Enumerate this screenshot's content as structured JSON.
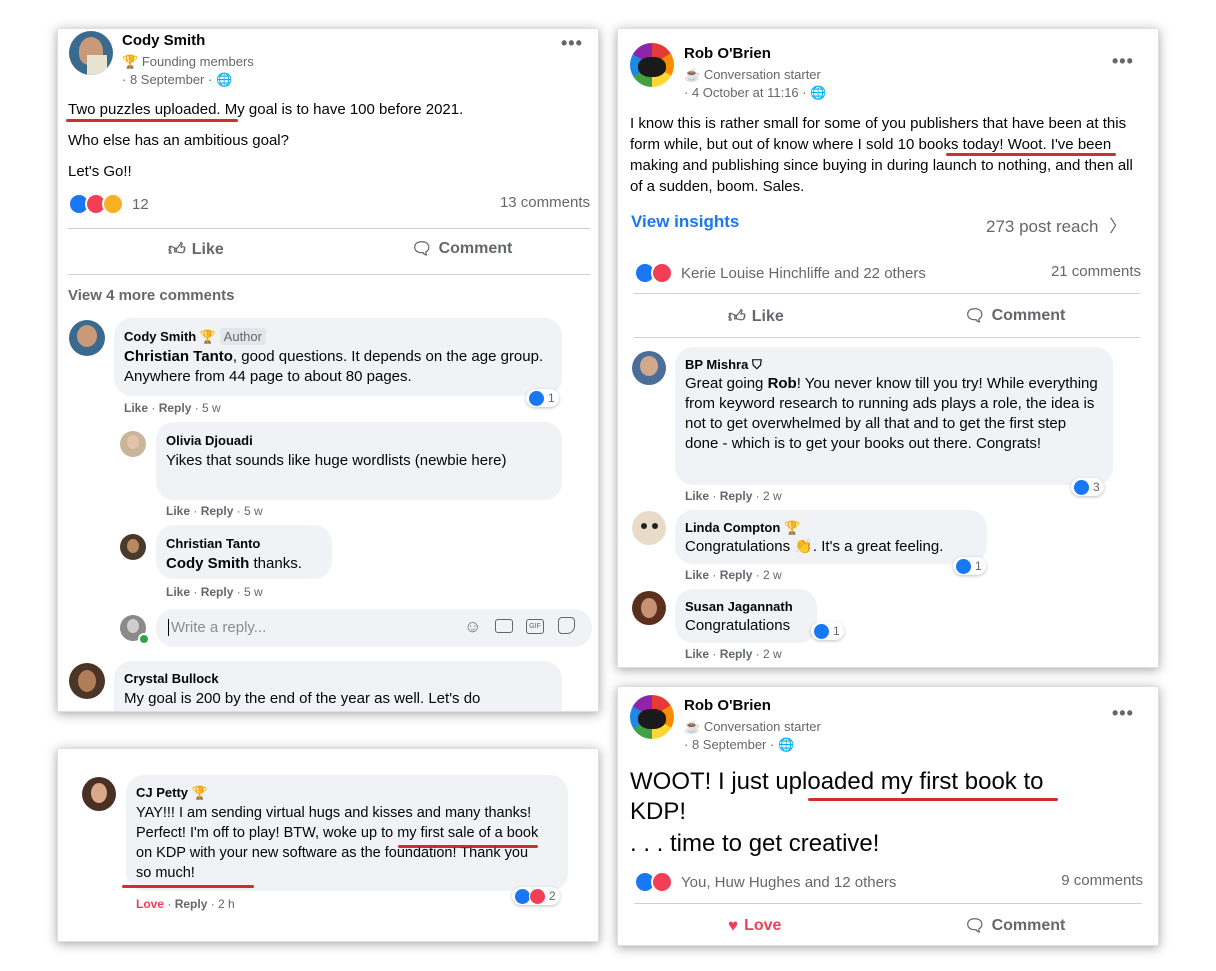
{
  "card1": {
    "author": "Cody Smith",
    "badge": "Founding members",
    "date": "· 8 September ·",
    "body": [
      "Two puzzles uploaded. My goal is to have 100 before 2021.",
      "Who else has an ambitious goal?",
      "Let's Go!!"
    ],
    "reaction_count": "12",
    "comments_count": "13 comments",
    "like_label": "Like",
    "comment_label": "Comment",
    "view_more": "View 4 more comments",
    "c1": {
      "name": "Cody Smith",
      "tag": "Author",
      "mention": "Christian Tanto",
      "text": ", good questions. It depends on the age group. Anywhere from 44 page to about 80 pages.",
      "like": "Like",
      "reply": "Reply",
      "time": "5 w",
      "reacts": "1"
    },
    "r1": {
      "name": "Olivia Djouadi",
      "text": "Yikes that sounds like huge wordlists (newbie here)",
      "like": "Like",
      "reply": "Reply",
      "time": "5 w"
    },
    "r2": {
      "name": "Christian Tanto",
      "mention": "Cody Smith",
      "text": " thanks.",
      "like": "Like",
      "reply": "Reply",
      "time": "5 w"
    },
    "reply_placeholder": "Write a reply...",
    "c2": {
      "name": "Crystal Bullock",
      "text": "My goal is 200 by the end of the year as well. Let's do"
    }
  },
  "card2": {
    "author": "Rob O'Brien",
    "badge": "Conversation starter",
    "date": "· 4 October at 11:16 ·",
    "body": "I know this is rather small for some of you publishers that have been at this form while, but out of know where I sold 10 books today! Woot. I've been making and publishing since buying in during launch to nothing, and then all of a sudden, boom. Sales.",
    "insights": "View insights",
    "reach": "273 post reach",
    "reactors": "Kerie Louise Hinchliffe and 22 others",
    "comments_count": "21 comments",
    "like_label": "Like",
    "comment_label": "Comment",
    "c1": {
      "name": "BP Mishra",
      "pre": "Great going ",
      "mention": "Rob",
      "text": "! You never know till you try! While everything from keyword research to running ads plays a role, the idea is not to get overwhelmed by all that and to get the first step done - which is to get your books out there. Congrats!",
      "like": "Like",
      "reply": "Reply",
      "time": "2 w",
      "reacts": "3"
    },
    "c2": {
      "name": "Linda Compton",
      "text_a": "Congratulations ",
      "text_b": ". It's a great feeling.",
      "like": "Like",
      "reply": "Reply",
      "time": "2 w",
      "reacts": "1"
    },
    "c3": {
      "name": "Susan Jagannath",
      "text": "Congratulations",
      "like": "Like",
      "reply": "Reply",
      "time": "2 w",
      "reacts": "1"
    }
  },
  "card3": {
    "name": "CJ Petty",
    "text": "YAY!!! I am sending virtual hugs and kisses and many thanks! Perfect! I'm off to play! BTW, woke up to my first sale of a book on KDP with your new software as the foundation! Thank you so much!",
    "love": "Love",
    "reply": "Reply",
    "time": "2 h",
    "reacts": "2"
  },
  "card4": {
    "author": "Rob O'Brien",
    "badge": "Conversation starter",
    "date": "· 8 September ·",
    "line1": "WOOT! I just uploaded my first book to KDP!",
    "line2": ". . . time to get creative!",
    "reactors": "You, Huw Hughes and 12 others",
    "comments_count": "9 comments",
    "love_label": "Love",
    "comment_label": "Comment"
  },
  "colors": {
    "accent": "#1877f2",
    "love": "#f33e58",
    "underline": "#c81a1a",
    "bubble": "#f0f2f5",
    "meta": "#65676b"
  }
}
